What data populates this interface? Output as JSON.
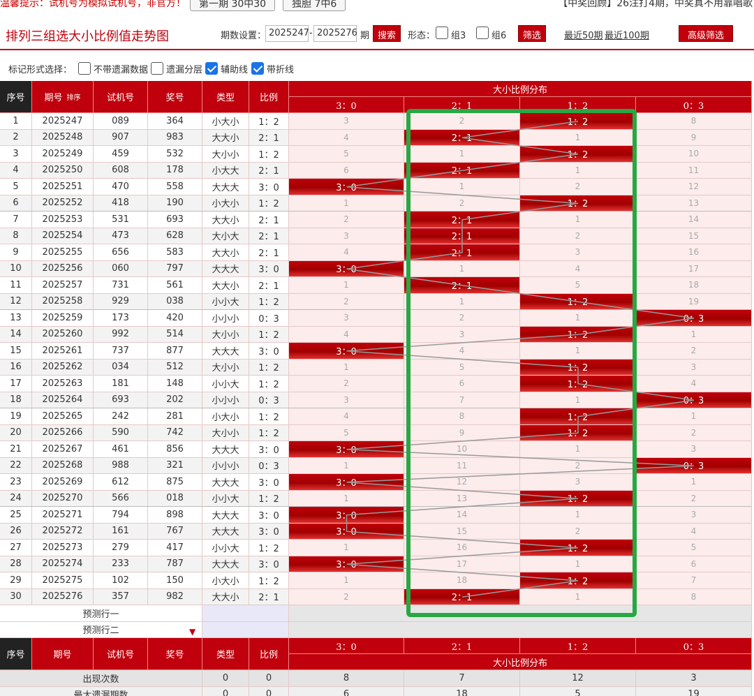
{
  "top": {
    "notice": "温馨提示：试机号为模拟试机号，非官方！",
    "btn1": "第一期 30中30",
    "btn2": "独胆 7中6",
    "right": "【中奖回顾】26注打4期，中奖真不用靠唱歌"
  },
  "header": {
    "title": "排列三组选大小比例值走势图",
    "period_label": "期数设置：",
    "start": "2025247",
    "dash": "-",
    "end": "2025276",
    "period_unit": "期",
    "search": "搜索",
    "form_label": "形态：",
    "z3": "组3",
    "z6": "组6",
    "filter": "筛选",
    "recent50": "最近50期",
    "recent100": "最近100期",
    "advanced": "高级筛选"
  },
  "markbar": {
    "label": "标记形式选择：",
    "opt1": "不带遗漏数据",
    "opt2": "遗漏分层",
    "opt3": "辅助线",
    "opt4": "带折线"
  },
  "table": {
    "h_seq": "序号",
    "h_issue": "期号",
    "h_sort": "排序",
    "h_trial": "试机号",
    "h_prize": "奖号",
    "h_type": "类型",
    "h_ratio": "比例",
    "h_dist": "大小比例分布",
    "dist_cols": [
      "3：0",
      "2：1",
      "1：2",
      "0：3"
    ],
    "rows": [
      {
        "seq": "1",
        "issue": "2025247",
        "trial": "089",
        "prize": "364",
        "type": "小大小",
        "ratio": "1：2",
        "hit": 2,
        "miss": [
          "3",
          "2",
          "",
          "8"
        ]
      },
      {
        "seq": "2",
        "issue": "2025248",
        "trial": "907",
        "prize": "983",
        "type": "大大小",
        "ratio": "2：1",
        "hit": 1,
        "miss": [
          "4",
          "",
          "1",
          "9"
        ]
      },
      {
        "seq": "3",
        "issue": "2025249",
        "trial": "459",
        "prize": "532",
        "type": "大小小",
        "ratio": "1：2",
        "hit": 2,
        "miss": [
          "5",
          "1",
          "",
          "10"
        ]
      },
      {
        "seq": "4",
        "issue": "2025250",
        "trial": "608",
        "prize": "178",
        "type": "小大大",
        "ratio": "2：1",
        "hit": 1,
        "miss": [
          "6",
          "",
          "1",
          "11"
        ]
      },
      {
        "seq": "5",
        "issue": "2025251",
        "trial": "470",
        "prize": "558",
        "type": "大大大",
        "ratio": "3：0",
        "hit": 0,
        "miss": [
          "",
          "1",
          "2",
          "12"
        ]
      },
      {
        "seq": "6",
        "issue": "2025252",
        "trial": "418",
        "prize": "190",
        "type": "小大小",
        "ratio": "1：2",
        "hit": 2,
        "miss": [
          "1",
          "2",
          "",
          "13"
        ]
      },
      {
        "seq": "7",
        "issue": "2025253",
        "trial": "531",
        "prize": "693",
        "type": "大大小",
        "ratio": "2：1",
        "hit": 1,
        "miss": [
          "2",
          "",
          "1",
          "14"
        ]
      },
      {
        "seq": "8",
        "issue": "2025254",
        "trial": "473",
        "prize": "628",
        "type": "大小大",
        "ratio": "2：1",
        "hit": 1,
        "miss": [
          "3",
          "",
          "2",
          "15"
        ]
      },
      {
        "seq": "9",
        "issue": "2025255",
        "trial": "656",
        "prize": "583",
        "type": "大大小",
        "ratio": "2：1",
        "hit": 1,
        "miss": [
          "4",
          "",
          "3",
          "16"
        ]
      },
      {
        "seq": "10",
        "issue": "2025256",
        "trial": "060",
        "prize": "797",
        "type": "大大大",
        "ratio": "3：0",
        "hit": 0,
        "miss": [
          "",
          "1",
          "4",
          "17"
        ]
      },
      {
        "seq": "11",
        "issue": "2025257",
        "trial": "731",
        "prize": "561",
        "type": "大大小",
        "ratio": "2：1",
        "hit": 1,
        "miss": [
          "1",
          "",
          "5",
          "18"
        ]
      },
      {
        "seq": "12",
        "issue": "2025258",
        "trial": "929",
        "prize": "038",
        "type": "小小大",
        "ratio": "1：2",
        "hit": 2,
        "miss": [
          "2",
          "1",
          "",
          "19"
        ]
      },
      {
        "seq": "13",
        "issue": "2025259",
        "trial": "173",
        "prize": "420",
        "type": "小小小",
        "ratio": "0：3",
        "hit": 3,
        "miss": [
          "3",
          "2",
          "1",
          ""
        ]
      },
      {
        "seq": "14",
        "issue": "2025260",
        "trial": "992",
        "prize": "514",
        "type": "大小小",
        "ratio": "1：2",
        "hit": 2,
        "miss": [
          "4",
          "3",
          "",
          "1"
        ]
      },
      {
        "seq": "15",
        "issue": "2025261",
        "trial": "737",
        "prize": "877",
        "type": "大大大",
        "ratio": "3：0",
        "hit": 0,
        "miss": [
          "",
          "4",
          "1",
          "2"
        ]
      },
      {
        "seq": "16",
        "issue": "2025262",
        "trial": "034",
        "prize": "512",
        "type": "大小小",
        "ratio": "1：2",
        "hit": 2,
        "miss": [
          "1",
          "5",
          "",
          "3"
        ]
      },
      {
        "seq": "17",
        "issue": "2025263",
        "trial": "181",
        "prize": "148",
        "type": "小小大",
        "ratio": "1：2",
        "hit": 2,
        "miss": [
          "2",
          "6",
          "",
          "4"
        ]
      },
      {
        "seq": "18",
        "issue": "2025264",
        "trial": "693",
        "prize": "202",
        "type": "小小小",
        "ratio": "0：3",
        "hit": 3,
        "miss": [
          "3",
          "7",
          "1",
          ""
        ]
      },
      {
        "seq": "19",
        "issue": "2025265",
        "trial": "242",
        "prize": "281",
        "type": "小大小",
        "ratio": "1：2",
        "hit": 2,
        "miss": [
          "4",
          "8",
          "",
          "1"
        ]
      },
      {
        "seq": "20",
        "issue": "2025266",
        "trial": "590",
        "prize": "742",
        "type": "大小小",
        "ratio": "1：2",
        "hit": 2,
        "miss": [
          "5",
          "9",
          "",
          "2"
        ]
      },
      {
        "seq": "21",
        "issue": "2025267",
        "trial": "461",
        "prize": "856",
        "type": "大大大",
        "ratio": "3：0",
        "hit": 0,
        "miss": [
          "",
          "10",
          "1",
          "3"
        ]
      },
      {
        "seq": "22",
        "issue": "2025268",
        "trial": "988",
        "prize": "321",
        "type": "小小小",
        "ratio": "0：3",
        "hit": 3,
        "miss": [
          "1",
          "11",
          "2",
          ""
        ]
      },
      {
        "seq": "23",
        "issue": "2025269",
        "trial": "612",
        "prize": "875",
        "type": "大大大",
        "ratio": "3：0",
        "hit": 0,
        "miss": [
          "",
          "12",
          "3",
          "1"
        ]
      },
      {
        "seq": "24",
        "issue": "2025270",
        "trial": "566",
        "prize": "018",
        "type": "小小大",
        "ratio": "1：2",
        "hit": 2,
        "miss": [
          "1",
          "13",
          "",
          "2"
        ]
      },
      {
        "seq": "25",
        "issue": "2025271",
        "trial": "794",
        "prize": "898",
        "type": "大大大",
        "ratio": "3：0",
        "hit": 0,
        "miss": [
          "",
          "14",
          "1",
          "3"
        ]
      },
      {
        "seq": "26",
        "issue": "2025272",
        "trial": "161",
        "prize": "767",
        "type": "大大大",
        "ratio": "3：0",
        "hit": 0,
        "miss": [
          "",
          "15",
          "2",
          "4"
        ]
      },
      {
        "seq": "27",
        "issue": "2025273",
        "trial": "279",
        "prize": "417",
        "type": "小小大",
        "ratio": "1：2",
        "hit": 2,
        "miss": [
          "1",
          "16",
          "",
          "5"
        ]
      },
      {
        "seq": "28",
        "issue": "2025274",
        "trial": "233",
        "prize": "787",
        "type": "大大大",
        "ratio": "3：0",
        "hit": 0,
        "miss": [
          "",
          "17",
          "1",
          "6"
        ]
      },
      {
        "seq": "29",
        "issue": "2025275",
        "trial": "102",
        "prize": "150",
        "type": "小大小",
        "ratio": "1：2",
        "hit": 2,
        "miss": [
          "1",
          "18",
          "",
          "7"
        ]
      },
      {
        "seq": "30",
        "issue": "2025276",
        "trial": "357",
        "prize": "982",
        "type": "大大小",
        "ratio": "2：1",
        "hit": 1,
        "miss": [
          "2",
          "",
          "1",
          "8"
        ]
      }
    ],
    "predict1": "预测行一",
    "predict2": "预测行二",
    "stat_appear": "出现次数",
    "stat_maxmiss": "最大遗漏期数",
    "appear": [
      "0",
      "0",
      "8",
      "7",
      "12",
      "3"
    ],
    "maxmiss": [
      "0",
      "0",
      "6",
      "18",
      "5",
      "19"
    ]
  },
  "colors": {
    "red": "#c0000c",
    "green": "#27a844",
    "rowAlt": "#f3f3f3",
    "pink": "#fcecec"
  }
}
